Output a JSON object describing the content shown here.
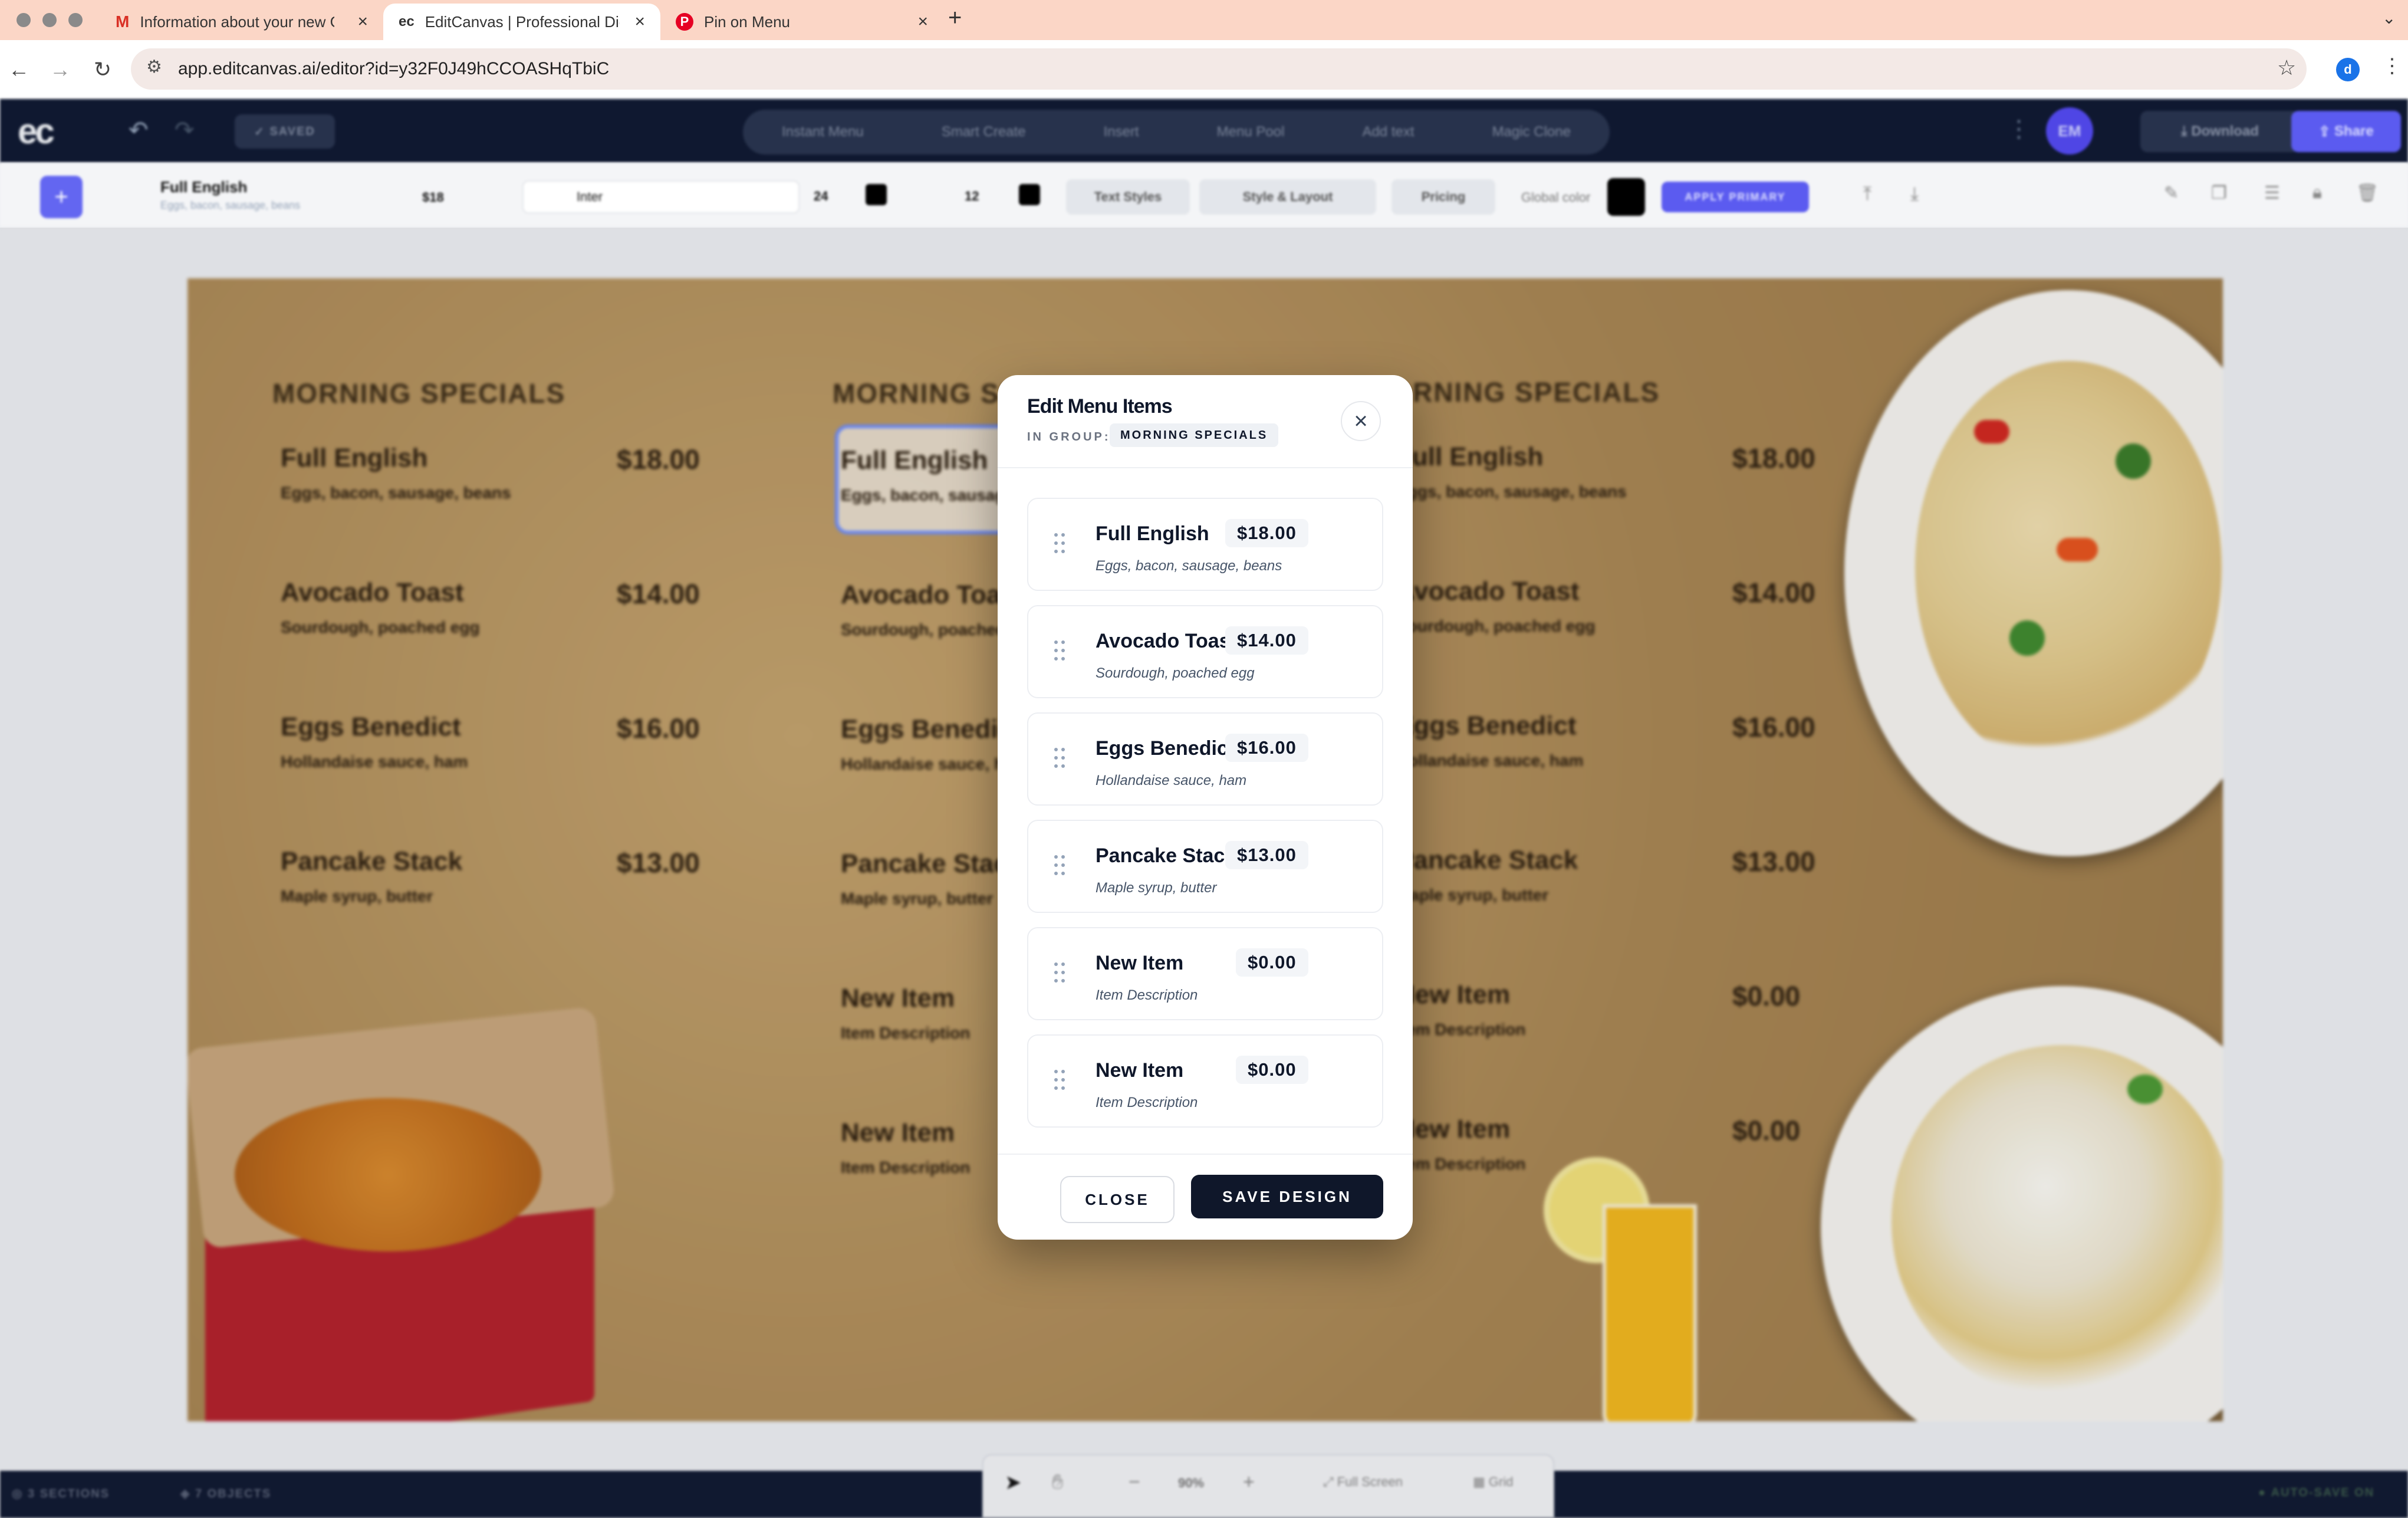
{
  "browser": {
    "tabs": [
      {
        "title": "Information about your new Google",
        "icon": "gmail-icon"
      },
      {
        "title": "EditCanvas | Professional Digital",
        "icon": "editcanvas-icon"
      },
      {
        "title": "Pin on Menu",
        "icon": "pinterest-icon"
      }
    ],
    "url": "app.editcanvas.ai/editor?id=y32F0J49hCCOASHqTbiC",
    "profile_initial": "d"
  },
  "app": {
    "logo": "ec",
    "saved_label": "SAVED",
    "toolbar_items": [
      "Instant Menu",
      "Smart Create",
      "Insert",
      "Menu Pool",
      "Add text",
      "Magic Clone"
    ],
    "avatar": "EM",
    "download_label": "Download",
    "share_label": "Share"
  },
  "subtoolbar": {
    "selected_name": "Full English",
    "selected_desc": "Eggs, bacon, sausage, beans",
    "selected_price": "$18",
    "font_name": "Inter",
    "font_size": "24",
    "desc_size": "12",
    "text_styles": "Text Styles",
    "style_layout": "Style & Layout",
    "pricing": "Pricing",
    "global_color": "Global color",
    "apply_primary": "APPLY PRIMARY"
  },
  "canvas": {
    "column_title": "MORNING SPECIALS",
    "items": [
      {
        "name": "Full English",
        "desc": "Eggs, bacon, sausage, beans",
        "price": "$18.00"
      },
      {
        "name": "Avocado Toast",
        "desc": "Sourdough, poached egg",
        "price": "$14.00"
      },
      {
        "name": "Eggs Benedict",
        "desc": "Hollandaise sauce, ham",
        "price": "$16.00"
      },
      {
        "name": "Pancake Stack",
        "desc": "Maple syrup, butter",
        "price": "$13.00"
      },
      {
        "name": "New Item",
        "desc": "Item Description",
        "price": "$0.00"
      },
      {
        "name": "New Item",
        "desc": "Item Description",
        "price": "$0.00"
      }
    ]
  },
  "modal": {
    "title": "Edit Menu Items",
    "group_label": "IN GROUP:",
    "group_name": "MORNING SPECIALS",
    "items": [
      {
        "name": "Full English",
        "price": "$18.00",
        "desc": "Eggs, bacon, sausage, beans"
      },
      {
        "name": "Avocado Toast",
        "price": "$14.00",
        "desc": "Sourdough, poached egg"
      },
      {
        "name": "Eggs Benedict",
        "price": "$16.00",
        "desc": "Hollandaise sauce, ham"
      },
      {
        "name": "Pancake Stack",
        "price": "$13.00",
        "desc": "Maple syrup, butter"
      },
      {
        "name": "New Item",
        "price": "$0.00",
        "desc": "Item Description"
      },
      {
        "name": "New Item",
        "price": "$0.00",
        "desc": "Item Description"
      }
    ],
    "close_label": "CLOSE",
    "save_label": "SAVE DESIGN"
  },
  "statusbar": {
    "sections": "3 SECTIONS",
    "objects": "7 OBJECTS",
    "zoom": "90%",
    "full_screen": "Full Screen",
    "grid": "Grid",
    "auto_save": "AUTO-SAVE ON"
  },
  "colors": {
    "accent": "#5b5bf0",
    "navy": "#0f1830",
    "save_button": "#0f172a"
  }
}
